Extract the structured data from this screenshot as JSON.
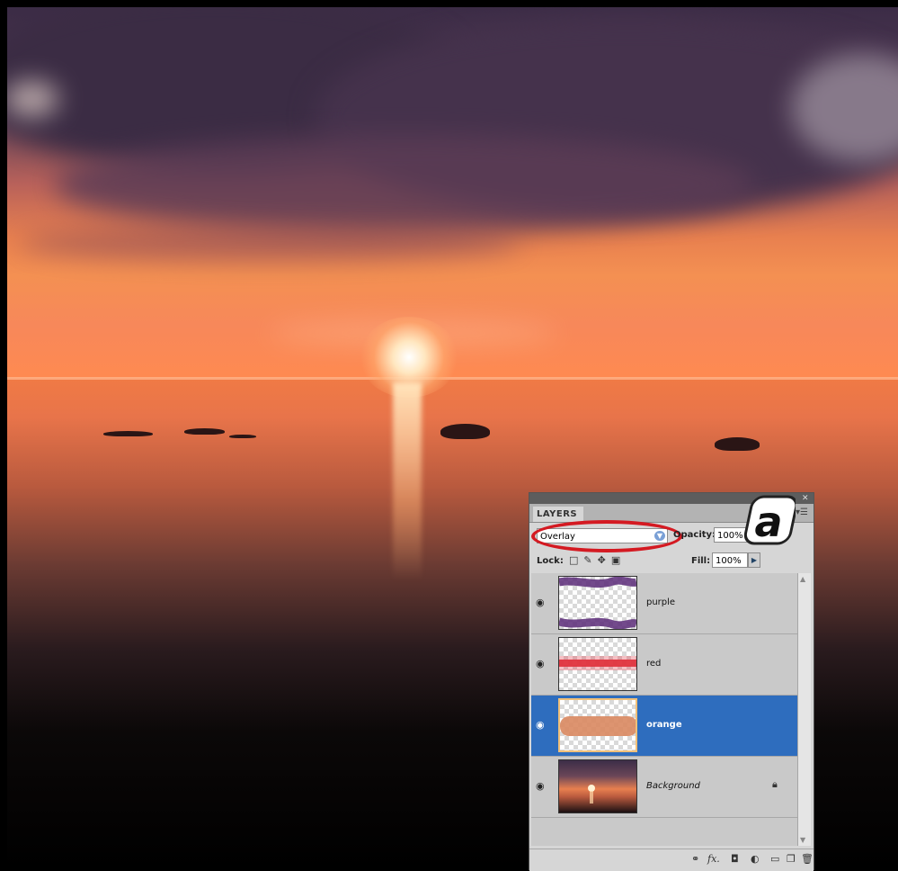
{
  "panel": {
    "tab_label": "LAYERS",
    "blend_mode": "Overlay",
    "opacity_label": "Opacity:",
    "opacity_value": "100%",
    "lock_label": "Lock:",
    "fill_label": "Fill:",
    "fill_value": "100%",
    "badge_letter": "a",
    "layers": [
      {
        "name": "purple",
        "visible": true,
        "selected": false
      },
      {
        "name": "red",
        "visible": true,
        "selected": false
      },
      {
        "name": "orange",
        "visible": true,
        "selected": true
      },
      {
        "name": "Background",
        "visible": true,
        "selected": false,
        "locked": true
      }
    ],
    "colors": {
      "selection": "#2e6dbe",
      "highlight_ring": "#d41a22",
      "purple_stroke": "#5a2a78",
      "red_stroke": "#e0303a",
      "orange_stroke": "#d98860"
    }
  }
}
